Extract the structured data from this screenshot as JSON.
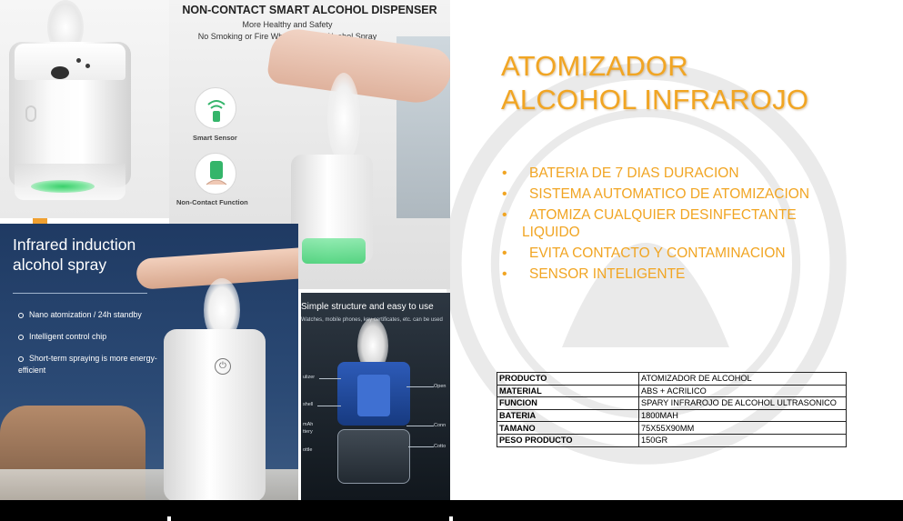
{
  "image_panels": {
    "dispenser": {
      "title": "NON-CONTACT SMART ALCOHOL DISPENSER",
      "subtitle_1": "More Healthy and Safety",
      "subtitle_2": "No Smoking or Fire When There Is Alcohol Spray",
      "feature_1": "Smart Sensor",
      "feature_2": "Non-Contact Function"
    },
    "infrared": {
      "headline_1": "Infrared induction",
      "headline_2": "alcohol spray",
      "bullets": [
        "Nano atomization / 24h standby",
        "Intelligent control chip",
        "Short-term spraying is more energy-efficient"
      ],
      "power_icon": "power-icon"
    },
    "structure": {
      "title": "Simple structure and easy to use",
      "caption": "Watches, mobile phones, key certificates, etc. can be used",
      "labels": [
        "ulizer",
        "shell",
        "mAh",
        "ttery",
        "ottle",
        "Open",
        "Conn",
        "Cotto"
      ]
    }
  },
  "heading": {
    "line_1": "ATOMIZADOR",
    "line_2": "ALCOHOL INFRAROJO"
  },
  "features": [
    "BATERIA DE 7 DIAS DURACION",
    "SISTEMA AUTOMATICO DE ATOMIZACION",
    "ATOMIZA CUALQUIER DESINFECTANTE",
    "LIQUIDO",
    "EVITA CONTACTO Y CONTAMINACION",
    "SENSOR INTELIGENTE"
  ],
  "spec_table": [
    {
      "key": "PRODUCTO",
      "value": "ATOMIZADOR DE ALCOHOL"
    },
    {
      "key": "MATERIAL",
      "value": "ABS + ACRILICO"
    },
    {
      "key": "FUNCION",
      "value": "SPARY INFRAROJO DE ALCOHOL ULTRASONICO"
    },
    {
      "key": "BATERIA",
      "value": "1800MAH"
    },
    {
      "key": "TAMANO",
      "value": "75X55X90MM"
    },
    {
      "key": "PESO PRODUCTO",
      "value": " 150GR"
    }
  ],
  "colors": {
    "accent": "#f1a523",
    "panel_blue": "#1f3a63",
    "bar": "#000000"
  }
}
